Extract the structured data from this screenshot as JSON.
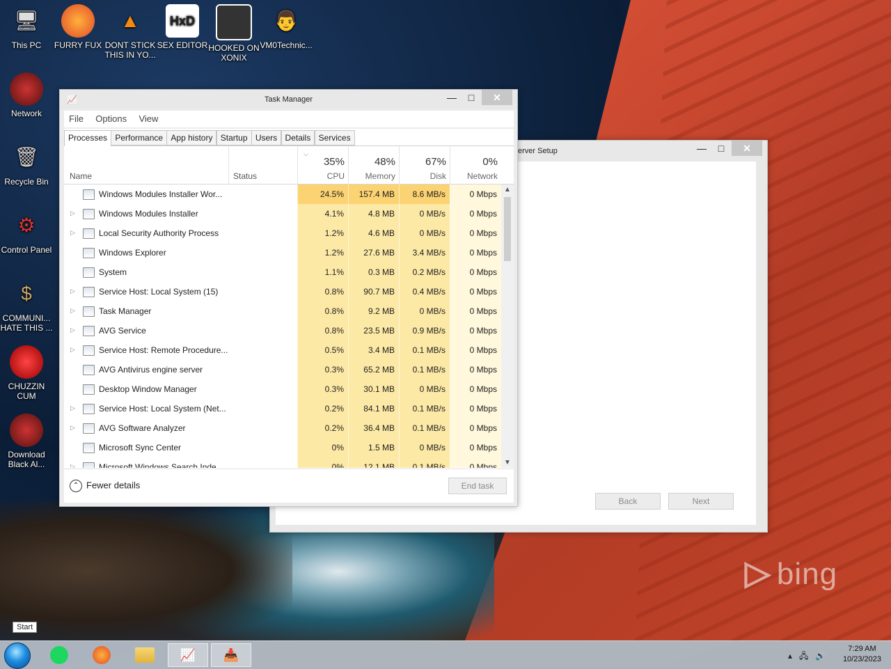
{
  "desktop_icons": [
    {
      "label": "This PC"
    },
    {
      "label": "FURRY FUX"
    },
    {
      "label": "DONT STICK THIS IN YO..."
    },
    {
      "label": "SEX EDITOR"
    },
    {
      "label": "HOOKED ON XONIX"
    },
    {
      "label": "VM0Technic..."
    },
    {
      "label": "Network"
    },
    {
      "label": "Recycle Bin"
    },
    {
      "label": "Control Panel"
    },
    {
      "label": "COMMUNI... HATE THIS ..."
    },
    {
      "label": "CHUZZIN CUM"
    },
    {
      "label": "Download Black Al..."
    }
  ],
  "setup_window": {
    "title": "erver Setup",
    "back_label": "Back",
    "next_label": "Next"
  },
  "task_manager": {
    "title": "Task Manager",
    "menu": [
      "File",
      "Options",
      "View"
    ],
    "tabs": [
      "Processes",
      "Performance",
      "App history",
      "Startup",
      "Users",
      "Details",
      "Services"
    ],
    "active_tab": "Processes",
    "columns": {
      "name": "Name",
      "status": "Status",
      "cpu": {
        "pct": "35%",
        "label": "CPU"
      },
      "memory": {
        "pct": "48%",
        "label": "Memory"
      },
      "disk": {
        "pct": "67%",
        "label": "Disk"
      },
      "network": {
        "pct": "0%",
        "label": "Network"
      }
    },
    "processes": [
      {
        "name": "Windows Modules Installer Wor...",
        "cpu": "24.5%",
        "memory": "157.4 MB",
        "disk": "8.6 MB/s",
        "network": "0 Mbps",
        "expandable": false
      },
      {
        "name": "Windows Modules Installer",
        "cpu": "4.1%",
        "memory": "4.8 MB",
        "disk": "0 MB/s",
        "network": "0 Mbps",
        "expandable": true
      },
      {
        "name": "Local Security Authority Process",
        "cpu": "1.2%",
        "memory": "4.6 MB",
        "disk": "0 MB/s",
        "network": "0 Mbps",
        "expandable": true
      },
      {
        "name": "Windows Explorer",
        "cpu": "1.2%",
        "memory": "27.6 MB",
        "disk": "3.4 MB/s",
        "network": "0 Mbps",
        "expandable": false
      },
      {
        "name": "System",
        "cpu": "1.1%",
        "memory": "0.3 MB",
        "disk": "0.2 MB/s",
        "network": "0 Mbps",
        "expandable": false
      },
      {
        "name": "Service Host: Local System (15)",
        "cpu": "0.8%",
        "memory": "90.7 MB",
        "disk": "0.4 MB/s",
        "network": "0 Mbps",
        "expandable": true
      },
      {
        "name": "Task Manager",
        "cpu": "0.8%",
        "memory": "9.2 MB",
        "disk": "0 MB/s",
        "network": "0 Mbps",
        "expandable": true
      },
      {
        "name": "AVG Service",
        "cpu": "0.8%",
        "memory": "23.5 MB",
        "disk": "0.9 MB/s",
        "network": "0 Mbps",
        "expandable": true
      },
      {
        "name": "Service Host: Remote Procedure...",
        "cpu": "0.5%",
        "memory": "3.4 MB",
        "disk": "0.1 MB/s",
        "network": "0 Mbps",
        "expandable": true
      },
      {
        "name": "AVG Antivirus engine server",
        "cpu": "0.3%",
        "memory": "65.2 MB",
        "disk": "0.1 MB/s",
        "network": "0 Mbps",
        "expandable": false
      },
      {
        "name": "Desktop Window Manager",
        "cpu": "0.3%",
        "memory": "30.1 MB",
        "disk": "0 MB/s",
        "network": "0 Mbps",
        "expandable": false
      },
      {
        "name": "Service Host: Local System (Net...",
        "cpu": "0.2%",
        "memory": "84.1 MB",
        "disk": "0.1 MB/s",
        "network": "0 Mbps",
        "expandable": true
      },
      {
        "name": "AVG Software Analyzer",
        "cpu": "0.2%",
        "memory": "36.4 MB",
        "disk": "0.1 MB/s",
        "network": "0 Mbps",
        "expandable": true
      },
      {
        "name": "Microsoft Sync Center",
        "cpu": "0%",
        "memory": "1.5 MB",
        "disk": "0 MB/s",
        "network": "0 Mbps",
        "expandable": false
      },
      {
        "name": "Microsoft Windows Search Inde...",
        "cpu": "0%",
        "memory": "12.1 MB",
        "disk": "0.1 MB/s",
        "network": "0 Mbps",
        "expandable": true
      }
    ],
    "fewer_details_label": "Fewer details",
    "end_task_label": "End task"
  },
  "taskbar": {
    "start_tooltip": "Start",
    "clock_time": "7:29 AM",
    "clock_date": "10/23/2023"
  },
  "wallpaper": {
    "watermark": "bing"
  }
}
